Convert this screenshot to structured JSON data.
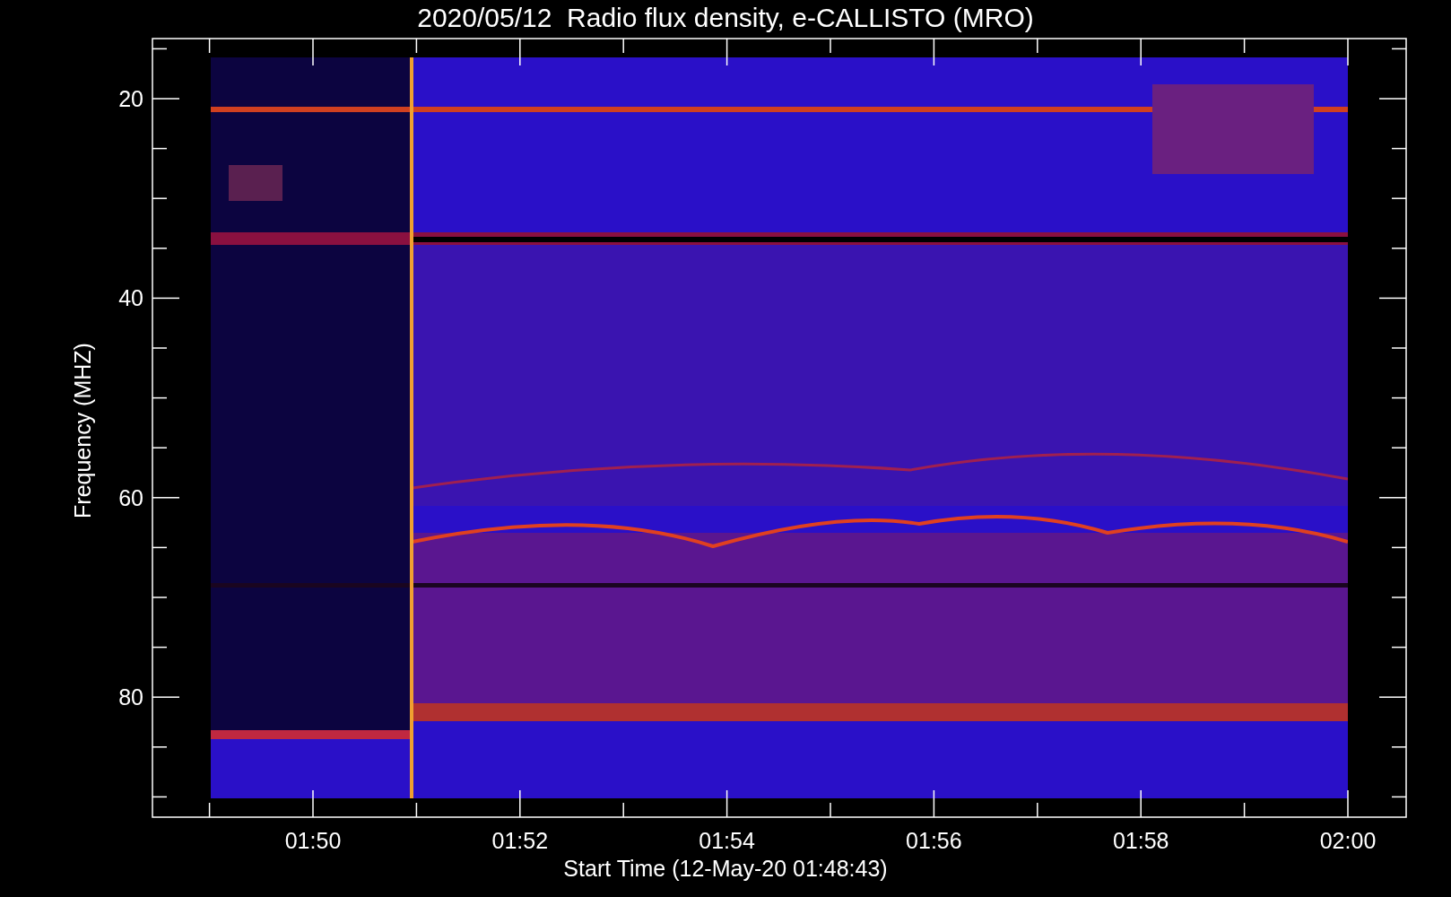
{
  "title": "2020/05/12  Radio flux density, e-CALLISTO (MRO)",
  "ylabel": "Frequency (MHZ)",
  "xlabel": "Start Time (12-May-20 01:48:43)",
  "yticks": [
    "20",
    "40",
    "60",
    "80"
  ],
  "xticks": [
    "01:50",
    "01:52",
    "01:54",
    "01:56",
    "01:58",
    "02:00"
  ]
}
